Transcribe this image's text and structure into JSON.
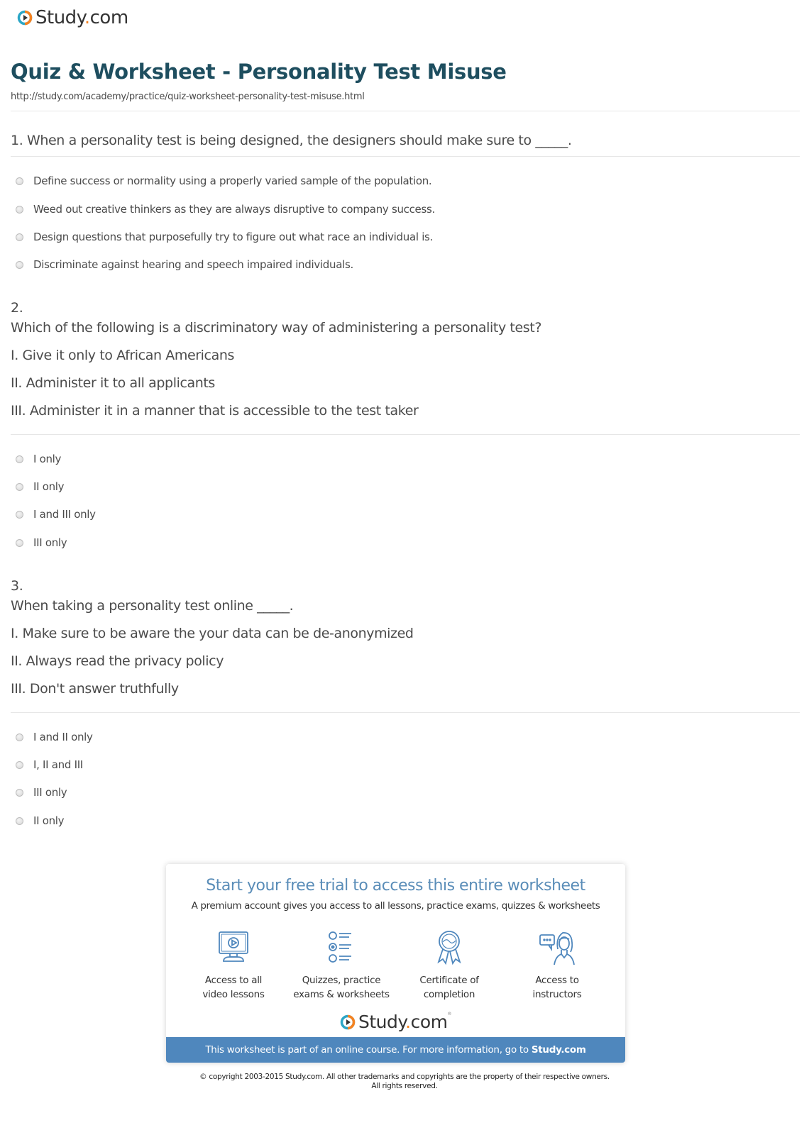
{
  "brand": {
    "name_part1": "Study",
    "name_dot": ".",
    "name_part2": "com",
    "colors": {
      "ring_teal": "#2ba6c6",
      "ring_orange": "#f58220",
      "text": "#333333",
      "title": "#1e4e5f",
      "accent_blue": "#4f87bd"
    }
  },
  "header": {
    "title": "Quiz & Worksheet - Personality Test Misuse",
    "url": "http://study.com/academy/practice/quiz-worksheet-personality-test-misuse.html"
  },
  "questions": [
    {
      "number": "1.",
      "lines": [
        "1. When a personality test is being designed, the designers should make sure to _____."
      ],
      "options": [
        "Define success or normality using a properly varied sample of the population.",
        "Weed out creative thinkers as they are always disruptive to company success.",
        "Design questions that purposefully try to figure out what race an individual is.",
        "Discriminate against hearing and speech impaired individuals."
      ]
    },
    {
      "number": "2.",
      "lines": [
        "Which of the following is a discriminatory way of administering a personality test?",
        "I. Give it only to African Americans",
        "II. Administer it to all applicants",
        "III. Administer it in a manner that is accessible to the test taker"
      ],
      "options": [
        "I only",
        "II only",
        "I and III only",
        "III only"
      ]
    },
    {
      "number": "3.",
      "lines": [
        "When taking a personality test online _____.",
        "I. Make sure to be aware the your data can be de-anonymized",
        "II. Always read the privacy policy",
        "III. Don't answer truthfully"
      ],
      "options": [
        "I and II only",
        "I, II and III",
        "III only",
        "II only"
      ]
    }
  ],
  "cta": {
    "title": "Start your free trial to access this entire worksheet",
    "subtitle": "A premium account gives you access to all lessons, practice exams, quizzes & worksheets",
    "features": [
      {
        "icon": "video-monitor-icon",
        "line1": "Access to all",
        "line2": "video lessons"
      },
      {
        "icon": "quiz-list-icon",
        "line1": "Quizzes, practice",
        "line2": "exams & worksheets"
      },
      {
        "icon": "certificate-ribbon-icon",
        "line1": "Certificate of",
        "line2": "completion"
      },
      {
        "icon": "instructor-chat-icon",
        "line1": "Access to",
        "line2": "instructors"
      }
    ],
    "footer_text": "This worksheet is part of an online course. For more information, go to ",
    "footer_link": "Study.com"
  },
  "copyright": {
    "line1": "© copyright 2003-2015 Study.com. All other trademarks and copyrights are the property of their respective owners.",
    "line2": "All rights reserved."
  }
}
